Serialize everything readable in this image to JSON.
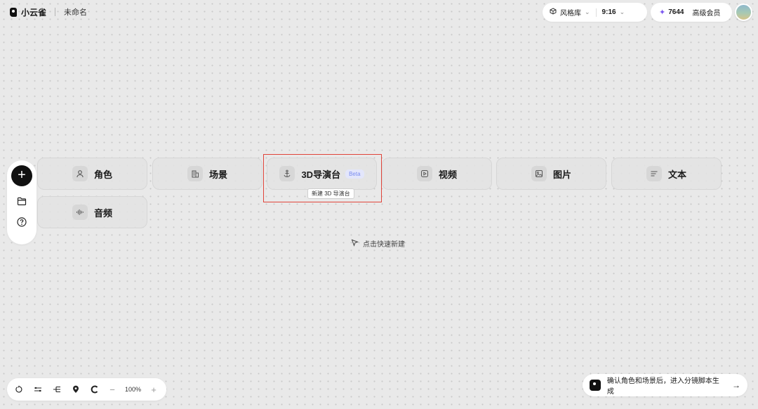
{
  "app": {
    "name": "小云雀",
    "document_title": "未命名"
  },
  "toolbar": {
    "style_library": "风格库",
    "aspect_ratio": "9:16",
    "credits": "7644",
    "membership": "高级会员"
  },
  "cards": [
    {
      "label": "角色",
      "icon": "person-icon"
    },
    {
      "label": "场景",
      "icon": "building-icon"
    },
    {
      "label": "3D导演台",
      "icon": "anchor-icon",
      "badge": "Beta",
      "tooltip": "新建 3D 导演台"
    },
    {
      "label": "视频",
      "icon": "play-icon"
    },
    {
      "label": "图片",
      "icon": "image-icon"
    },
    {
      "label": "文本",
      "icon": "text-lines-icon"
    },
    {
      "label": "音频",
      "icon": "waveform-icon"
    }
  ],
  "hint": "点击快速新建",
  "zoom": {
    "value": "100%",
    "minus": "−",
    "plus": "+"
  },
  "cta": {
    "text": "确认角色和场景后，进入分镜脚本生成"
  },
  "colors": {
    "highlight": "#e0443a",
    "credits_star": "#7b57f0",
    "beta_text": "#7a8cf0"
  }
}
